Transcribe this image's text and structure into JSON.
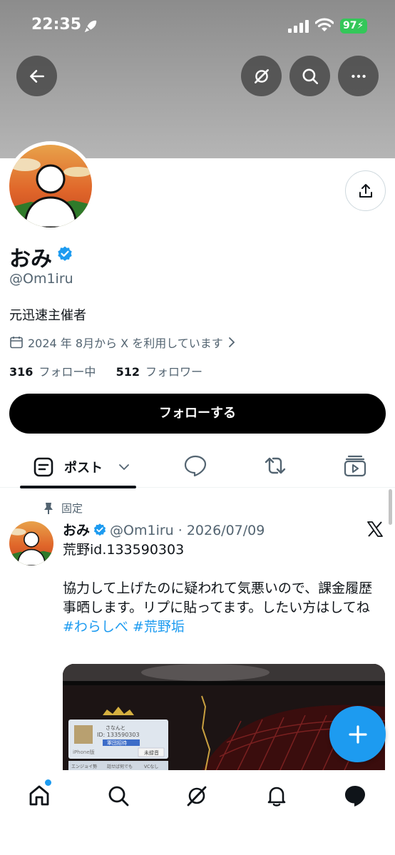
{
  "status_bar": {
    "time": "22:35",
    "battery": "97"
  },
  "header": {
    "back_icon": "arrow-left-icon",
    "grok_icon": "grok-icon",
    "search_icon": "search-icon",
    "more_icon": "more-icon"
  },
  "profile": {
    "name": "おみ",
    "handle": "@Om1iru",
    "bio": "元迅速主催者",
    "joined": "2024 年 8月から X を利用しています",
    "following_count": "316",
    "following_label": "フォロー中",
    "followers_count": "512",
    "followers_label": "フォロワー",
    "follow_button": "フォローする"
  },
  "tabs": {
    "posts_label": "ポスト"
  },
  "pinned_post": {
    "pin_label": "固定",
    "author": "おみ",
    "meta": "@Om1iru · 2026/07/09",
    "line1": "荒野id.133590303",
    "line2": "協力して上げたのに疑われて気悪いので、課金履歴事晒します。リプに貼ってます。したい方はしてね",
    "hashtags": "#わらしべ #荒野垢",
    "media": {
      "name_label": "さなんと",
      "id_label": "ID: 133590303",
      "tag1": "軍団招待",
      "iphone_label": "iPhone版",
      "tag2": "未録音",
      "chip1": "エンジョイ勢",
      "chip2": "話せば何でも",
      "chip3": "VCなし"
    }
  },
  "colors": {
    "accent": "#1d9bf0",
    "verified": "#1d9bf0",
    "battery": "#34c759"
  }
}
